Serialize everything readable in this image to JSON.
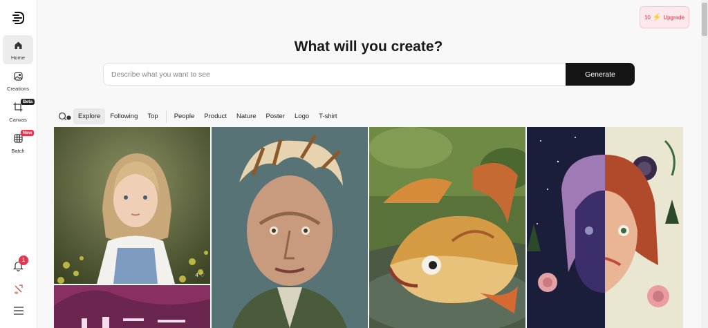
{
  "sidebar": {
    "items": [
      {
        "label": "Home",
        "icon": "home-icon"
      },
      {
        "label": "Creations",
        "icon": "image-icon"
      },
      {
        "label": "Canvas",
        "icon": "crop-icon",
        "badge": "Beta"
      },
      {
        "label": "Batch",
        "icon": "grid-icon",
        "badge": "New"
      }
    ],
    "notifications": "1"
  },
  "upgrade": {
    "credits": "10",
    "label": "Upgrade"
  },
  "headline": "What will you create?",
  "prompt": {
    "placeholder": "Describe what you want to see",
    "value": ""
  },
  "generate_label": "Generate",
  "filters": [
    "Explore",
    "Following",
    "Top",
    "People",
    "Product",
    "Nature",
    "Poster",
    "Logo",
    "T-shirt"
  ],
  "active_filter": "Explore",
  "gallery": {
    "first_card_likes": "4"
  },
  "colors": {
    "accent": "#e8344e",
    "button": "#141414"
  }
}
